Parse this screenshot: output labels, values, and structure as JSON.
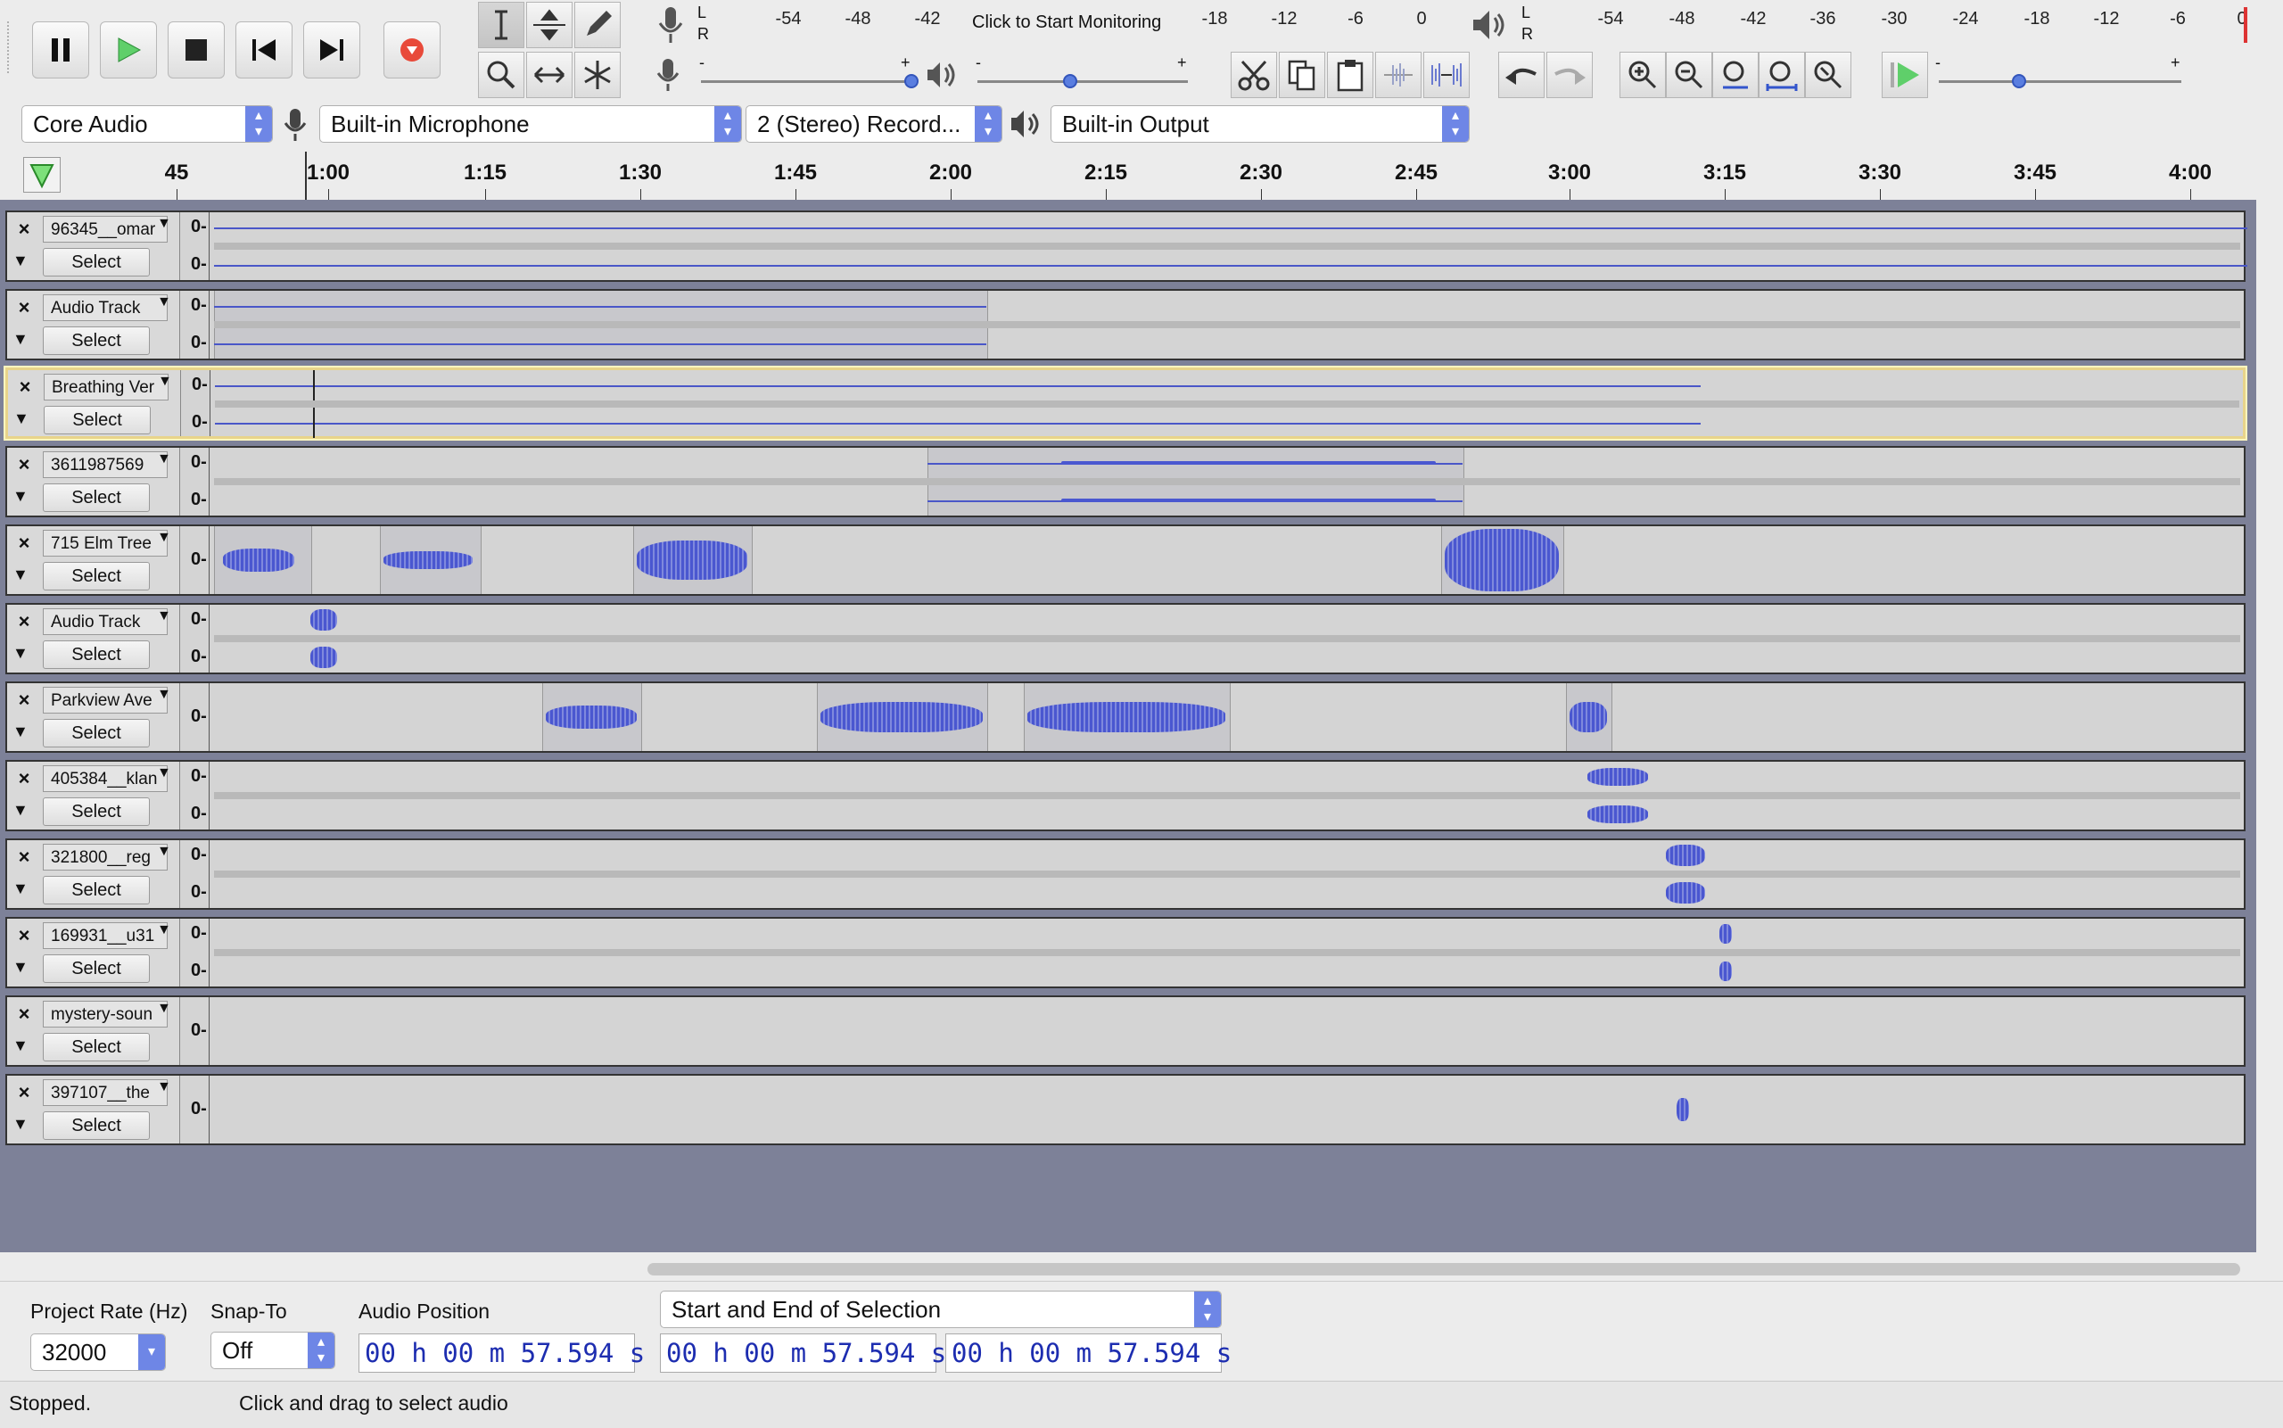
{
  "toolbar": {
    "meter_record_scale": [
      "-54",
      "-48",
      "-42",
      "-18",
      "-12",
      "-6",
      "0"
    ],
    "monitor_label": "Click to Start Monitoring",
    "meter_play_scale": [
      "-54",
      "-48",
      "-42",
      "-36",
      "-30",
      "-24",
      "-18",
      "-12",
      "-6",
      "0"
    ],
    "lr_top": "L",
    "lr_bottom": "R",
    "slider_minus": "-",
    "slider_plus": "+"
  },
  "devices": {
    "host": "Core Audio",
    "input": "Built-in Microphone",
    "channels": "2 (Stereo) Record...",
    "output": "Built-in Output"
  },
  "ruler": {
    "labels": [
      "45",
      "1:00",
      "1:15",
      "1:30",
      "1:45",
      "2:00",
      "2:15",
      "2:30",
      "2:45",
      "3:00",
      "3:15",
      "3:30",
      "3:45",
      "4:00"
    ]
  },
  "tracks": [
    {
      "name": "96345__omar",
      "select": "Select",
      "scale": "0-"
    },
    {
      "name": "Audio Track",
      "select": "Select",
      "scale": "0-"
    },
    {
      "name": "Breathing Ver",
      "select": "Select",
      "scale": "0-"
    },
    {
      "name": "3611987569",
      "select": "Select",
      "scale": "0-"
    },
    {
      "name": "715 Elm Tree",
      "select": "Select",
      "scale": "0-"
    },
    {
      "name": "Audio Track",
      "select": "Select",
      "scale": "0-"
    },
    {
      "name": "Parkview Ave",
      "select": "Select",
      "scale": "0-"
    },
    {
      "name": "405384__klan",
      "select": "Select",
      "scale": "0-"
    },
    {
      "name": "321800__reg",
      "select": "Select",
      "scale": "0-"
    },
    {
      "name": "169931__u31",
      "select": "Select",
      "scale": "0-"
    },
    {
      "name": "mystery-soun",
      "select": "Select",
      "scale": "0-"
    },
    {
      "name": "397107__the",
      "select": "Select",
      "scale": "0-"
    }
  ],
  "bottom": {
    "project_rate_label": "Project Rate (Hz)",
    "project_rate": "32000",
    "snap_label": "Snap-To",
    "snap_value": "Off",
    "audio_position_label": "Audio Position",
    "selection_mode": "Start and End of Selection",
    "audio_position": "00 h 00 m 57.594 s",
    "selection_start": "00 h 00 m 57.594 s",
    "selection_end": "00 h 00 m 57.594 s"
  },
  "status": {
    "state": "Stopped.",
    "hint": "Click and drag to select audio"
  },
  "colors": {
    "waveform": "#4a57d0",
    "track_background": "#7d8198",
    "selected_border": "#e8d48a"
  }
}
